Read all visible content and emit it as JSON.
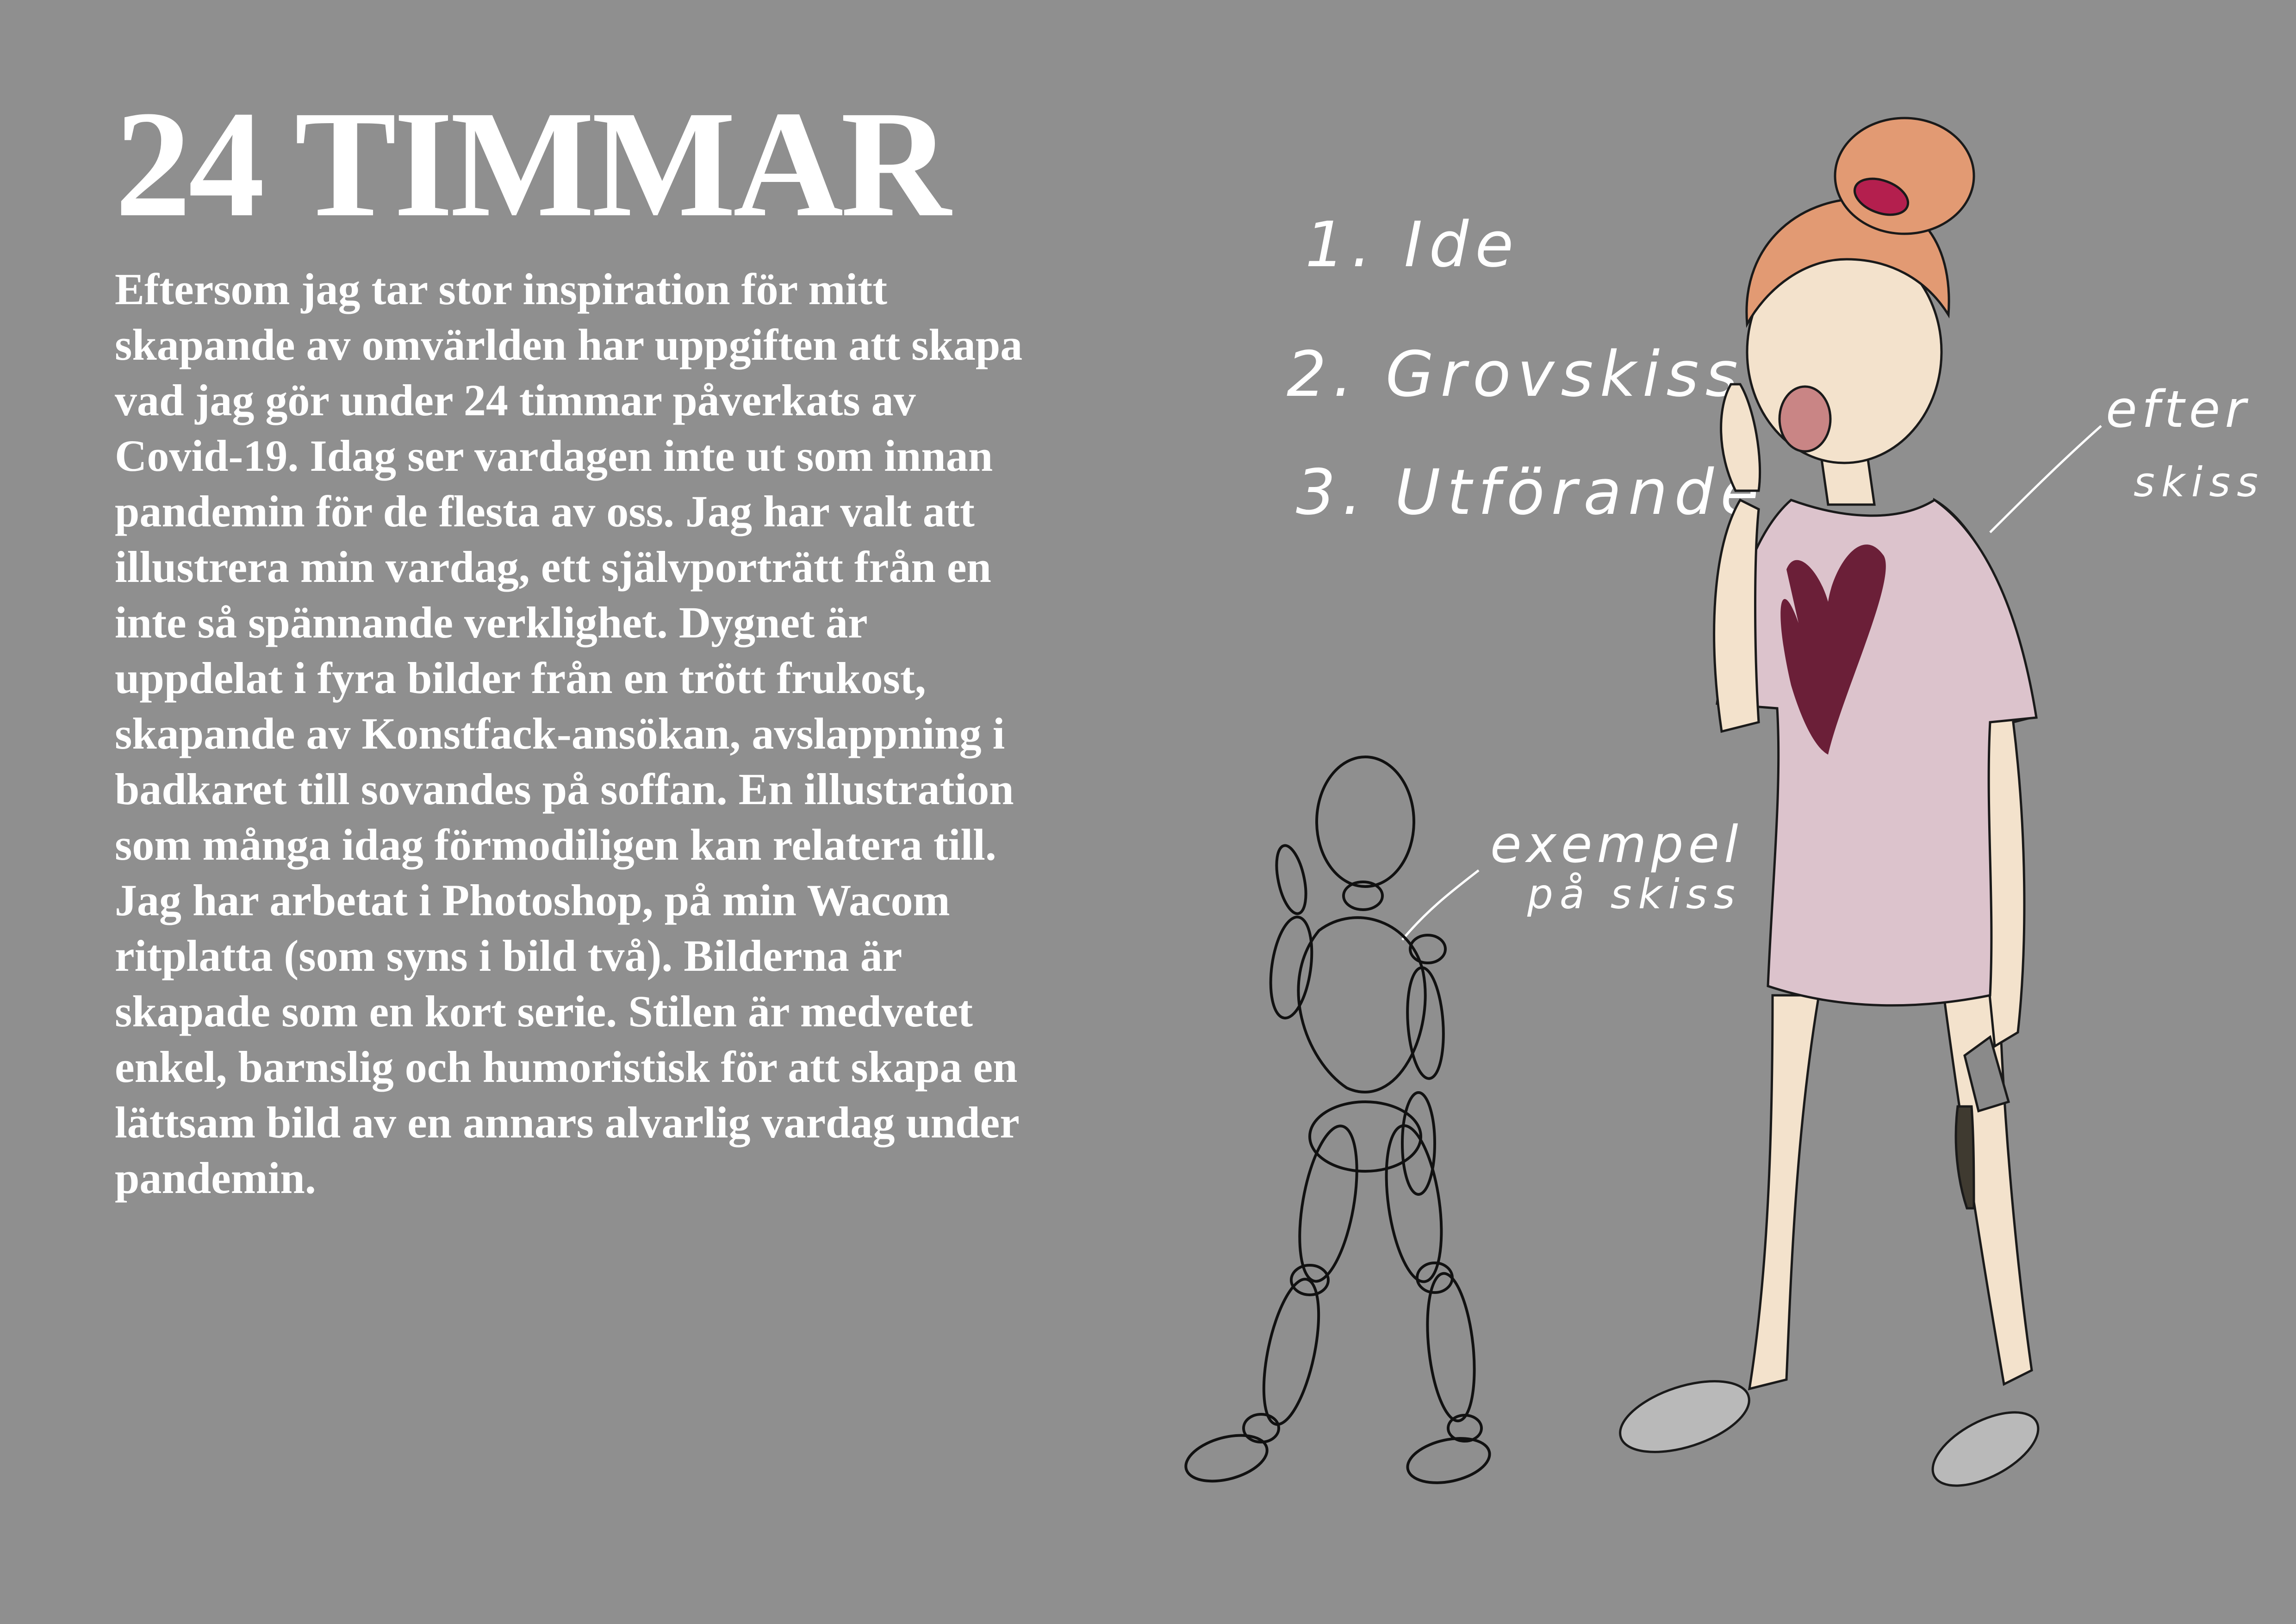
{
  "page": {
    "title": "24 TIMMAR",
    "body_lines": [
      "Eftersom jag tar stor inspiration för mitt",
      "skapande av omvärlden har uppgiften att skapa",
      "vad jag gör under 24 timmar påverkats av",
      "Covid-19. Idag ser vardagen inte ut som innan",
      "pandemin för de flesta av oss. Jag har valt att",
      "illustrera min vardag, ett självporträtt från en",
      "inte så spännande verklighet. Dygnet är",
      "uppdelat i fyra bilder från en trött frukost,",
      "skapande av Konstfack-ansökan, avslappning i",
      "badkaret till sovandes på soffan. En illustration",
      "som många idag förmodiligen kan relatera till.",
      "Jag har arbetat i Photoshop, på min Wacom",
      "ritplatta (som syns i bild två). Bilderna är",
      "skapade som en kort serie. Stilen är medvetet",
      "enkel, barnslig och humoristisk för att skapa en",
      "lättsam bild av en annars alvarlig vardag under",
      "pandemin."
    ]
  },
  "steps": [
    "1. Ide",
    "2. Grovskiss",
    "3. Utförande"
  ],
  "annotations": {
    "sketch_label_line1": "exempel",
    "sketch_label_line2": "på skiss",
    "after_label_line1": "efter",
    "after_label_line2": "skiss"
  },
  "colors": {
    "background": "#8f8f8f",
    "text": "#ffffff",
    "shirt": "#dcc3cc",
    "heart": "#6b1f38",
    "skin": "#f3e2cc",
    "hair": "#e29a73",
    "scrunchie": "#b41f4e",
    "slipper": "#b9b9b9"
  }
}
